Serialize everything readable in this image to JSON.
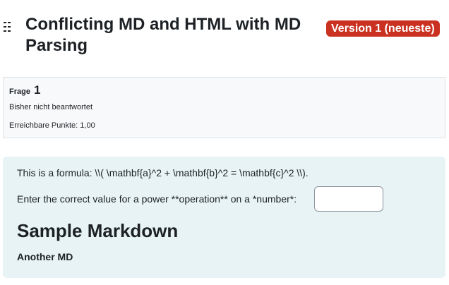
{
  "question": {
    "title": "Conflicting MD and HTML with MD Parsing",
    "version_badge": "Version 1 (neueste)"
  },
  "info": {
    "label": "Frage",
    "number": "1",
    "state": "Bisher nicht beantwortet",
    "marks": "Erreichbare Punkte: 1,00"
  },
  "content": {
    "formula_text": "This is a formula: \\\\( \\mathbf{a}^2 + \\mathbf{b}^2 = \\mathbf{c}^2 \\\\).",
    "prompt_text": "Enter the correct value for a power **operation** on a *number*:",
    "answer_value": "",
    "heading": "Sample Markdown",
    "subheading": "Another MD"
  },
  "colors": {
    "badge": "#ca3120",
    "content_bg": "#e7f3f5",
    "info_bg": "#f8f9fa"
  }
}
